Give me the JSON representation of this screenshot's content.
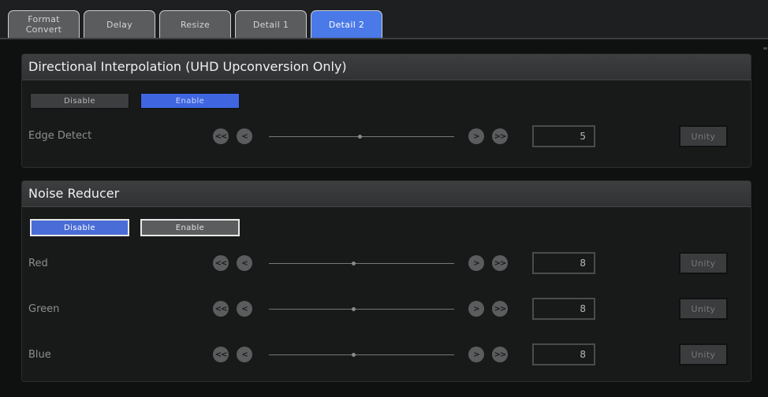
{
  "tabs": [
    {
      "label_line1": "Format",
      "label_line2": "Convert",
      "active": false
    },
    {
      "label": "Delay",
      "active": false
    },
    {
      "label": "Resize",
      "active": false
    },
    {
      "label": "Detail 1",
      "active": false
    },
    {
      "label": "Detail 2",
      "active": true
    }
  ],
  "directional": {
    "title": "Directional Interpolation (UHD Upconversion Only)",
    "disable_label": "Disable",
    "enable_label": "Enable",
    "selected": "Enable",
    "edge": {
      "label": "Edge Detect",
      "value": "5",
      "unity_label": "Unity"
    }
  },
  "noise": {
    "title": "Noise Reducer",
    "disable_label": "Disable",
    "enable_label": "Enable",
    "selected": "Disable",
    "rows": [
      {
        "label": "Red",
        "value": "8",
        "unity_label": "Unity"
      },
      {
        "label": "Green",
        "value": "8",
        "unity_label": "Unity"
      },
      {
        "label": "Blue",
        "value": "8",
        "unity_label": "Unity"
      }
    ]
  },
  "slider_buttons": {
    "fast_back": "<<",
    "back": "<",
    "forward": ">",
    "fast_forward": ">>"
  },
  "colors": {
    "accent": "#4a6cd6",
    "active_tab": "#4a79e8",
    "panel_header": "#3a3c3e",
    "background": "#0f1010"
  }
}
